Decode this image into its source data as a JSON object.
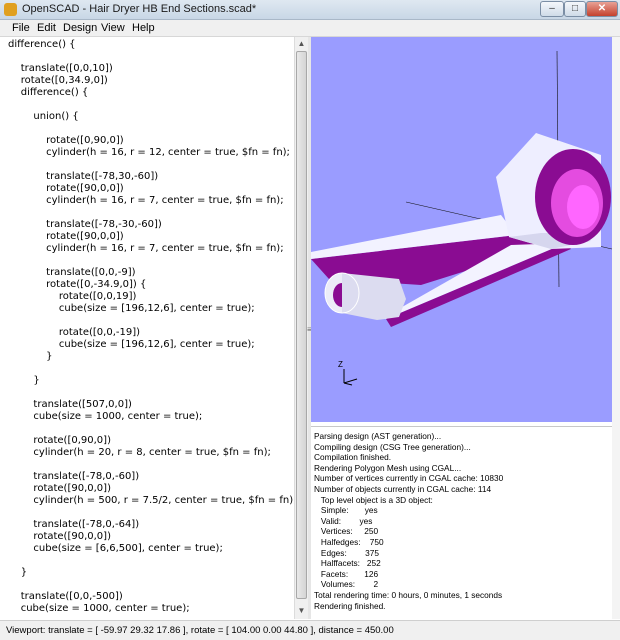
{
  "window": {
    "title": "OpenSCAD - Hair Dryer HB End Sections.scad*",
    "minimize": "–",
    "maximize": "□",
    "close": "✕"
  },
  "menu": [
    "File",
    "Edit",
    "Design",
    "View",
    "Help"
  ],
  "editor": {
    "lines": [
      "difference() {",
      "",
      "    translate([0,0,10])",
      "    rotate([0,34.9,0])",
      "    difference() {",
      "",
      "        union() {",
      "",
      "            rotate([0,90,0])",
      "            cylinder(h = 16, r = 12, center = true, $fn = fn);",
      "",
      "            translate([-78,30,-60])",
      "            rotate([90,0,0])",
      "            cylinder(h = 16, r = 7, center = true, $fn = fn);",
      "",
      "            translate([-78,-30,-60])",
      "            rotate([90,0,0])",
      "            cylinder(h = 16, r = 7, center = true, $fn = fn);",
      "",
      "            translate([0,0,-9])",
      "            rotate([0,-34.9,0]) {",
      "                rotate([0,0,19])",
      "                cube(size = [196,12,6], center = true);",
      "",
      "                rotate([0,0,-19])",
      "                cube(size = [196,12,6], center = true);",
      "            }",
      "",
      "        }",
      "",
      "        translate([507,0,0])",
      "        cube(size = 1000, center = true);",
      "",
      "        rotate([0,90,0])",
      "        cylinder(h = 20, r = 8, center = true, $fn = fn);",
      "",
      "        translate([-78,0,-60])",
      "        rotate([90,0,0])",
      "        cylinder(h = 500, r = 7.5/2, center = true, $fn = fn);",
      "",
      "        translate([-78,0,-64])",
      "        rotate([90,0,0])",
      "        cube(size = [6,6,500], center = true);",
      "",
      "    }",
      "",
      "    translate([0,0,-500])",
      "    cube(size = 1000, center = true);"
    ]
  },
  "splitter_glyph": "≡",
  "viewport": {
    "axis_label": "Z",
    "background": "#9a9cff",
    "accent": "#8a0c92"
  },
  "console": {
    "lines": [
      "Parsing design (AST generation)...",
      "Compiling design (CSG Tree generation)...",
      "Compilation finished.",
      "Rendering Polygon Mesh using CGAL...",
      "Number of vertices currently in CGAL cache: 10830",
      "Number of objects currently in CGAL cache: 114",
      "   Top level object is a 3D object:",
      "   Simple:       yes",
      "   Valid:        yes",
      "   Vertices:     250",
      "   Halfedges:    750",
      "   Edges:        375",
      "   Halffacets:   252",
      "   Facets:       126",
      "   Volumes:        2",
      "Total rendering time: 0 hours, 0 minutes, 1 seconds",
      "Rendering finished."
    ]
  },
  "status": "Viewport: translate = [ -59.97 29.32 17.86 ], rotate = [ 104.00 0.00 44.80 ], distance = 450.00"
}
